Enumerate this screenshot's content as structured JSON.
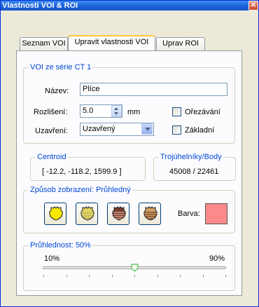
{
  "window": {
    "title": "Vlastnosti VOI & ROI",
    "close_icon": "close-icon"
  },
  "tabs": [
    {
      "label": "Seznam VOI",
      "active": false
    },
    {
      "label": "Upravit vlastnosti VOI",
      "active": true
    },
    {
      "label": "Uprav ROI",
      "active": false
    }
  ],
  "voi_group": {
    "legend": "VOI ze série CT 1",
    "name_label": "Název:",
    "name_value": "Plíce",
    "resolution_label": "Rozlišení:",
    "resolution_value": "5.0",
    "resolution_unit": "mm",
    "closure_label": "Uzavření:",
    "closure_value": "Uzavřený",
    "clipping_label": "Ořezávání",
    "clipping_checked": false,
    "basic_label": "Základní",
    "basic_checked": false
  },
  "centroid": {
    "legend": "Centroid",
    "value": "[ -12.2, -118.2, 1599.9 ]"
  },
  "triangles": {
    "legend": "Trojúhelníky/Body",
    "value": "45008 / 22461"
  },
  "display_mode": {
    "legend": "Způsob zobrazení: Průhledný",
    "buttons": [
      {
        "icon": "transparent-shape-icon",
        "fill": "#f8e800"
      },
      {
        "icon": "mesh-shape-icon",
        "fill": "#e0d560"
      },
      {
        "icon": "solid-shape-icon",
        "fill": "#7a3a2a"
      },
      {
        "icon": "striped-shape-icon",
        "fill": "#d2a060"
      }
    ],
    "color_label": "Barva:",
    "color_value": "#fb8b8b"
  },
  "transparency": {
    "legend": "Průhlednost: 50%",
    "min_label": "10%",
    "max_label": "90%",
    "value_percent": 50
  }
}
